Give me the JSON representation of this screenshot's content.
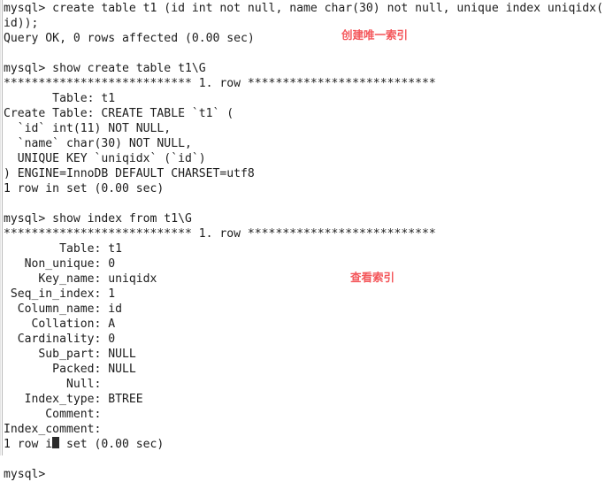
{
  "terminal": {
    "prompt": "mysql>",
    "background_color": "#ffffff",
    "text_color": "#1c1c1c",
    "annotation_color": "#f4575b",
    "lines": [
      "mysql> create table t1 (id int not null, name char(30) not null, unique index uniqidx(",
      "id));",
      "Query OK, 0 rows affected (0.00 sec)",
      "",
      "mysql> show create table t1\\G",
      "*************************** 1. row ***************************",
      "       Table: t1",
      "Create Table: CREATE TABLE `t1` (",
      "  `id` int(11) NOT NULL,",
      "  `name` char(30) NOT NULL,",
      "  UNIQUE KEY `uniqidx` (`id`)",
      ") ENGINE=InnoDB DEFAULT CHARSET=utf8",
      "1 row in set (0.00 sec)",
      "",
      "mysql> show index from t1\\G",
      "*************************** 1. row ***************************",
      "        Table: t1",
      "   Non_unique: 0",
      "     Key_name: uniqidx",
      " Seq_in_index: 1",
      "  Column_name: id",
      "    Collation: A",
      "  Cardinality: 0",
      "     Sub_part: NULL",
      "       Packed: NULL",
      "         Null: ",
      "   Index_type: BTREE",
      "      Comment: ",
      "Index_comment: ",
      "1 row in set (0.00 sec)",
      "",
      "mysql> "
    ],
    "statements": [
      {
        "command": "create table t1 (id int not null, name char(30) not null, unique index uniqidx(id));",
        "result": "Query OK, 0 rows affected (0.00 sec)"
      },
      {
        "command": "show create table t1\\G",
        "row_header": "*************************** 1. row ***************************",
        "fields": [
          {
            "label": "Table",
            "value": "t1"
          },
          {
            "label": "Create Table",
            "value": "CREATE TABLE `t1` ("
          }
        ],
        "ddl_body": [
          "  `id` int(11) NOT NULL,",
          "  `name` char(30) NOT NULL,",
          "  UNIQUE KEY `uniqidx` (`id`)",
          ") ENGINE=InnoDB DEFAULT CHARSET=utf8"
        ],
        "result": "1 row in set (0.00 sec)"
      },
      {
        "command": "show index from t1\\G",
        "row_header": "*************************** 1. row ***************************",
        "fields": [
          {
            "label": "Table",
            "value": "t1"
          },
          {
            "label": "Non_unique",
            "value": "0"
          },
          {
            "label": "Key_name",
            "value": "uniqidx"
          },
          {
            "label": "Seq_in_index",
            "value": "1"
          },
          {
            "label": "Column_name",
            "value": "id"
          },
          {
            "label": "Collation",
            "value": "A"
          },
          {
            "label": "Cardinality",
            "value": "0"
          },
          {
            "label": "Sub_part",
            "value": "NULL"
          },
          {
            "label": "Packed",
            "value": "NULL"
          },
          {
            "label": "Null",
            "value": ""
          },
          {
            "label": "Index_type",
            "value": "BTREE"
          },
          {
            "label": "Comment",
            "value": ""
          },
          {
            "label": "Index_comment",
            "value": ""
          }
        ],
        "result": "1 row in set (0.00 sec)"
      }
    ]
  },
  "annotations": {
    "create_unique_index": "创建唯一索引",
    "view_index": "查看索引"
  }
}
